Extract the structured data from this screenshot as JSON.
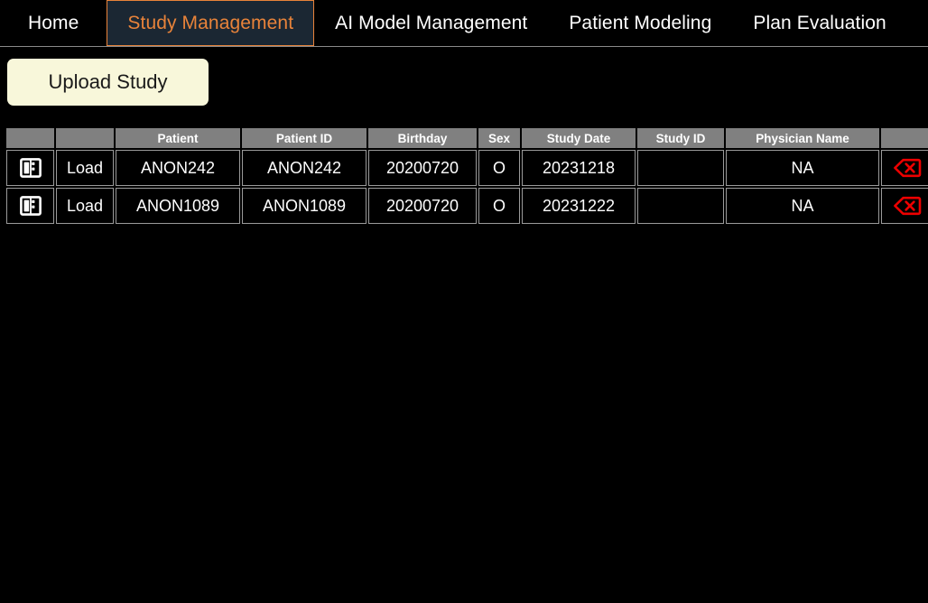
{
  "tabs": [
    {
      "label": "Home",
      "active": false
    },
    {
      "label": "Study Management",
      "active": true
    },
    {
      "label": "AI Model Management",
      "active": false
    },
    {
      "label": "Patient Modeling",
      "active": false
    },
    {
      "label": "Plan Evaluation",
      "active": false
    }
  ],
  "toolbar": {
    "upload_study_label": "Upload Study"
  },
  "table": {
    "columns": [
      "",
      "",
      "Patient",
      "Patient ID",
      "Birthday",
      "Sex",
      "Study Date",
      "Study ID",
      "Physician Name",
      ""
    ],
    "load_label": "Load",
    "open_icon": "panel-layout-icon",
    "delete_icon": "backspace-delete-icon",
    "rows": [
      {
        "patient": "ANON242",
        "patient_id": "ANON242",
        "birthday": "20200720",
        "sex": "O",
        "study_date": "20231218",
        "study_id": "",
        "physician_name": "NA"
      },
      {
        "patient": "ANON1089",
        "patient_id": "ANON1089",
        "birthday": "20200720",
        "sex": "O",
        "study_date": "20231222",
        "study_id": "",
        "physician_name": "NA"
      }
    ]
  },
  "colors": {
    "background": "#000000",
    "accent_orange": "#e8833a",
    "active_tab_fill": "#1b2733",
    "header_gray": "#808080",
    "upload_button": "#f8f7da",
    "delete_red": "#ee0000"
  }
}
